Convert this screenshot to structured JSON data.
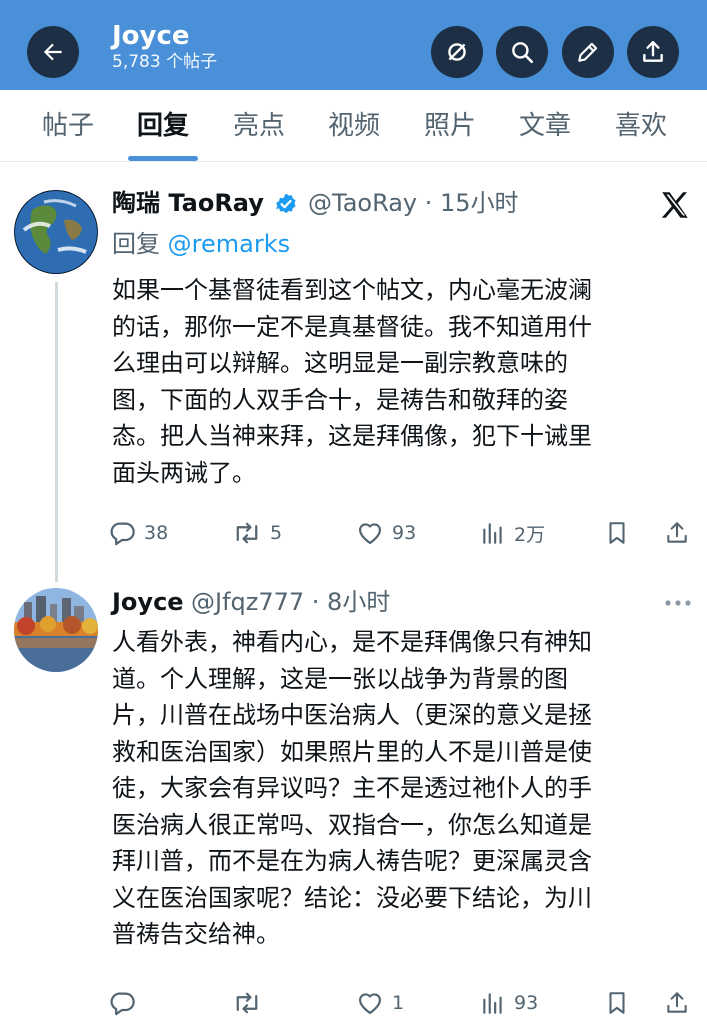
{
  "header": {
    "title": "Joyce",
    "subtitle": "5,783 个帖子"
  },
  "tabs": [
    {
      "label": "帖子"
    },
    {
      "label": "回复"
    },
    {
      "label": "亮点"
    },
    {
      "label": "视频"
    },
    {
      "label": "照片"
    },
    {
      "label": "文章"
    },
    {
      "label": "喜欢"
    }
  ],
  "active_tab": "回复",
  "posts": [
    {
      "name": "陶瑞 TaoRay",
      "verified": true,
      "handle_time": "@TaoRay · 15小时",
      "reply_prefix": "回复 ",
      "reply_to": "@remarks",
      "lines": [
        "如果一个基督徒看到这个帖文，内心毫无波澜",
        "的话，那你一定不是真基督徒。我不知道用什",
        "么理由可以辩解。这明显是一副宗教意味的",
        "图，下面的人双手合十，是祷告和敬拜的姿",
        "态。把人当神来拜，这是拜偶像，犯下十诫里",
        "面头两诫了。"
      ],
      "stats": {
        "replies": "38",
        "reposts": "5",
        "likes": "93",
        "views": "2万"
      }
    },
    {
      "name": "Joyce",
      "handle_time": "@Jfqz777 · 8小时",
      "lines": [
        "人看外表，神看内心，是不是拜偶像只有神知",
        "道。个人理解，这是一张以战争为背景的图",
        "片，川普在战场中医治病人（更深的意义是拯",
        "救和医治国家）如果照片里的人不是川普是使",
        "徒，大家会有异议吗？主不是透过祂仆人的手",
        "医治病人很正常吗、双指合一，你怎么知道是",
        "拜川普，而不是在为病人祷告呢？更深属灵含",
        "义在医治国家呢？结论：没必要下结论，为川",
        "普祷告交给神。"
      ],
      "stats": {
        "replies": "",
        "reposts": "",
        "likes": "1",
        "views": "93"
      }
    }
  ],
  "colors": {
    "header_bg": "#4a90d9",
    "verified": "#1d9bf0",
    "mention": "#1d9bf0"
  }
}
